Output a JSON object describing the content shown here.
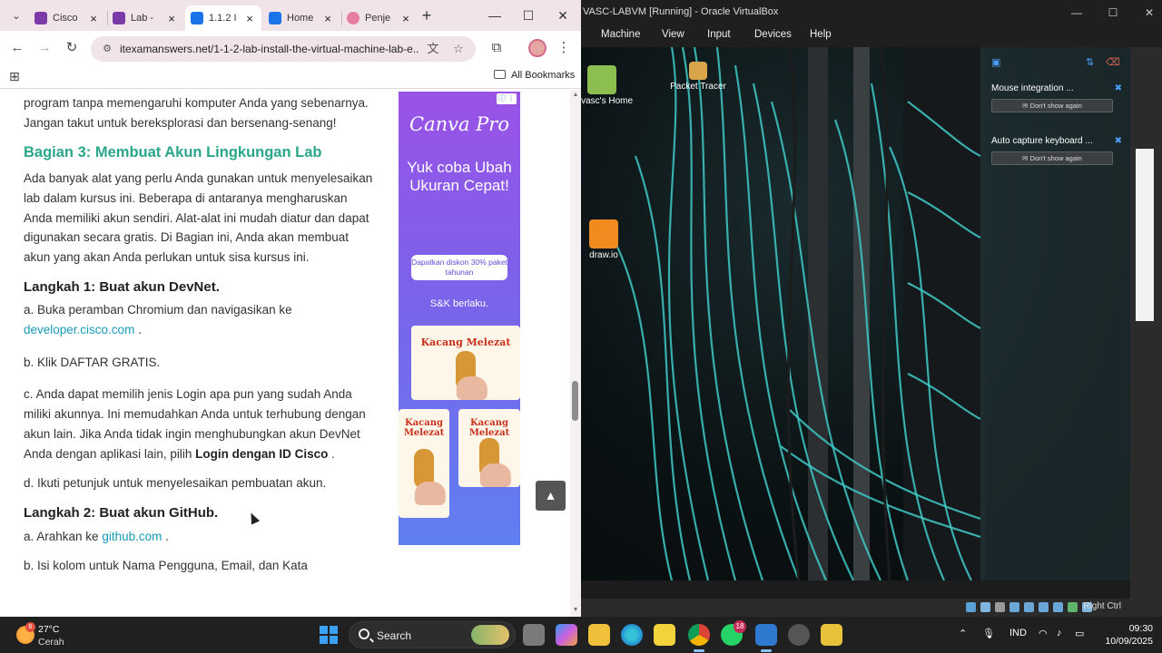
{
  "chrome": {
    "tabs": [
      {
        "label": "Cisco",
        "favicon_color": "#7b3aa8"
      },
      {
        "label": "Lab -",
        "favicon_color": "#7b3aa8"
      },
      {
        "label": "1.1.2 I",
        "favicon_color": "#1a73e8"
      },
      {
        "label": "Home",
        "favicon_color": "#1a73e8"
      },
      {
        "label": "Penje",
        "favicon_color": "#e57fa0"
      }
    ],
    "active_tab_index": 2,
    "url": "itexamanswers.net/1-1-2-lab-install-the-virtual-machine-lab-e...",
    "bookmarks_label": "All Bookmarks"
  },
  "article": {
    "intro_p": "program tanpa memengaruhi komputer Anda yang sebenarnya. Jangan takut untuk bereksplorasi dan bersenang-senang!",
    "section_heading": "Bagian 3: Membuat Akun Lingkungan Lab",
    "section_p": "Ada banyak alat yang perlu Anda gunakan untuk menyelesaikan lab dalam kursus ini. Beberapa di antaranya mengharuskan Anda memiliki akun sendiri. Alat-alat ini mudah diatur dan dapat digunakan secara gratis. Di Bagian ini, Anda akan membuat akun yang akan Anda perlukan untuk sisa kursus ini.",
    "step1_heading": "Langkah 1: Buat akun DevNet.",
    "step1_a_text": "a. Buka peramban Chromium dan navigasikan ke",
    "step1_a_link": "developer.cisco.com",
    "step1_a_tail": " .",
    "step1_b": "b. Klik DAFTAR GRATIS.",
    "step1_c_text": "c. Anda dapat memilih jenis Login apa pun yang sudah Anda miliki akunnya. Ini memudahkan Anda untuk terhubung dengan akun lain. Jika Anda tidak ingin menghubungkan akun DevNet Anda dengan aplikasi lain, pilih ",
    "step1_c_bold": "Login dengan ID Cisco",
    "step1_c_tail": " .",
    "step1_d": "d. Ikuti petunjuk untuk menyelesaikan pembuatan akun.",
    "step2_heading": "Langkah 2: Buat akun GitHub.",
    "step2_a_text": "a. Arahkan ke ",
    "step2_a_link": "github.com",
    "step2_a_tail": " .",
    "step2_b_partial": "b. Isi kolom untuk Nama Pengguna, Email, dan Kata"
  },
  "ad": {
    "brand": "Canva Pro",
    "headline": "Yuk coba Ubah Ukuran Cepat!",
    "promo": "Dapatkan diskon 30% paket tahunan",
    "terms": "S&K berlaku.",
    "card_title": "Kacang Melezat"
  },
  "vbox": {
    "title": "VASC-LABVM [Running] - Oracle VirtualBox",
    "menus": [
      "Machine",
      "View",
      "Input",
      "Devices",
      "Help"
    ],
    "desktop_icons": [
      "devasc's Home",
      "Packet Tracer",
      "draw.io"
    ],
    "notifications": [
      {
        "title": "Mouse integration ...",
        "button": "Don't show again"
      },
      {
        "title": "Auto capture keyboard ...",
        "button": "Don't show again"
      }
    ],
    "host_key": "Right Ctrl"
  },
  "taskbar": {
    "weather_temp": "27°C",
    "weather_cond": "Cerah",
    "weather_badge": "6",
    "search_label": "Search",
    "whatsapp_badge": "18",
    "language": "IND",
    "time": "09:30",
    "date": "10/09/2025"
  },
  "colors": {
    "accent_heading": "#2aa68a",
    "link": "#1a9bb8",
    "cable": "#3fc9c6"
  }
}
